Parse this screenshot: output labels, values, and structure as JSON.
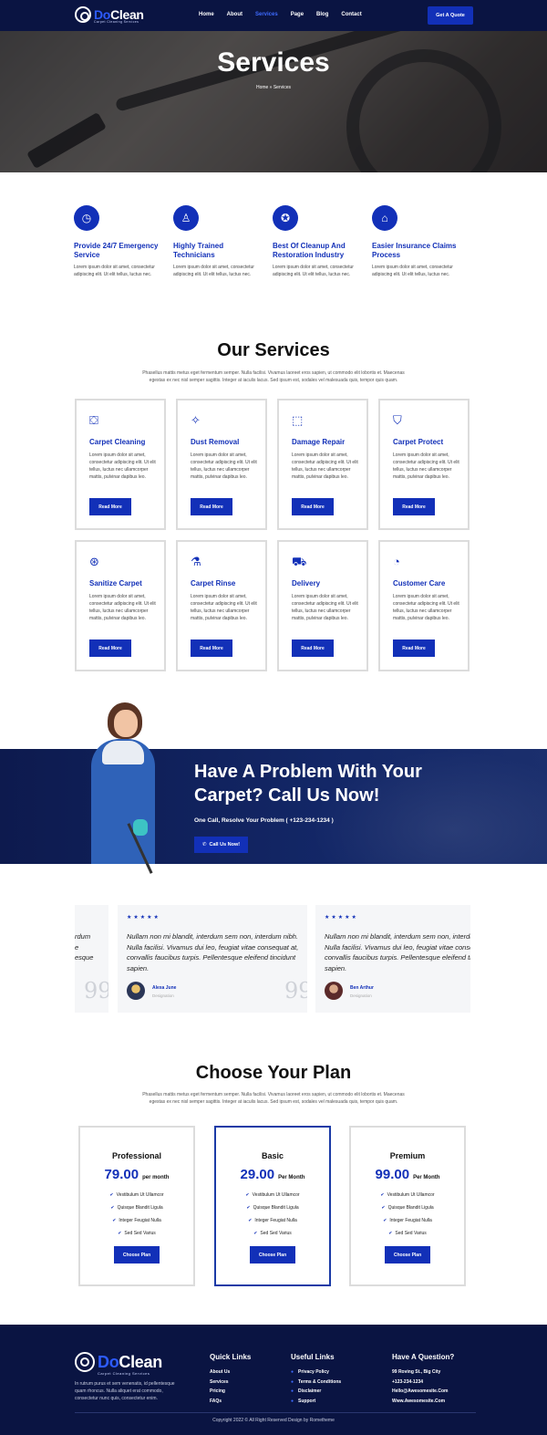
{
  "brand": {
    "name_a": "Do",
    "name_b": "Clean",
    "tagline": "Carpet Cleaning Services"
  },
  "nav": {
    "links": [
      "Home",
      "About",
      "Services",
      "Page",
      "Blog",
      "Contact"
    ],
    "active": "Services",
    "cta": "Get A Quote"
  },
  "hero": {
    "title": "Services",
    "breadcrumb": "Home » Services"
  },
  "features": [
    {
      "icon": "clock-24-icon",
      "title": "Provide 24/7 Emergency Service",
      "desc": "Lorem ipsum dolor sit amet, consectetur adipiscing elit. Ut elit tellus, luctus nec."
    },
    {
      "icon": "technician-icon",
      "title": "Highly Trained Technicians",
      "desc": "Lorem ipsum dolor sit amet, consectetur adipiscing elit. Ut elit tellus, luctus nec."
    },
    {
      "icon": "award-icon",
      "title": "Best Of Cleanup And Restoration Industry",
      "desc": "Lorem ipsum dolor sit amet, consectetur adipiscing elit. Ut elit tellus, luctus nec."
    },
    {
      "icon": "insurance-icon",
      "title": "Easier Insurance Claims Process",
      "desc": "Lorem ipsum dolor sit amet, consectetur adipiscing elit. Ut elit tellus, luctus nec."
    }
  ],
  "services": {
    "title": "Our Services",
    "desc": "Phasellus mattis metus eget fermentum semper. Nulla facilisi. Vivamus laoreet eros sapien, ut commodo elit lobortis et. Maecenas egestas ex nec nisl semper sagittis. Integer at iaculis lacus. Sed ipsum est, sodales vel malesuada quis, tempor quis quam.",
    "items": [
      {
        "icon": "cleaning-icon",
        "title": "Carpet Cleaning",
        "desc": "Lorem ipsum dolor sit amet, consectetur adipiscing elit. Ut elit tellus, luctus nec ullamcorper mattis, pulvinar dapibus leo.",
        "button": "Read More"
      },
      {
        "icon": "wand-icon",
        "title": "Dust Removal",
        "desc": "Lorem ipsum dolor sit amet, consectetur adipiscing elit. Ut elit tellus, luctus nec ullamcorper mattis, pulvinar dapibus leo.",
        "button": "Read More"
      },
      {
        "icon": "repair-icon",
        "title": "Damage Repair",
        "desc": "Lorem ipsum dolor sit amet, consectetur adipiscing elit. Ut elit tellus, luctus nec ullamcorper mattis, pulvinar dapibus leo.",
        "button": "Read More"
      },
      {
        "icon": "shield-icon",
        "title": "Carpet Protect",
        "desc": "Lorem ipsum dolor sit amet, consectetur adipiscing elit. Ut elit tellus, luctus nec ullamcorper mattis, pulvinar dapibus leo.",
        "button": "Read More"
      },
      {
        "icon": "sanitize-icon",
        "title": "Sanitize Carpet",
        "desc": "Lorem ipsum dolor sit amet, consectetur adipiscing elit. Ut elit tellus, luctus nec ullamcorper mattis, pulvinar dapibus leo.",
        "button": "Read More"
      },
      {
        "icon": "flask-icon",
        "title": "Carpet Rinse",
        "desc": "Lorem ipsum dolor sit amet, consectetur adipiscing elit. Ut elit tellus, luctus nec ullamcorper mattis, pulvinar dapibus leo.",
        "button": "Read More"
      },
      {
        "icon": "truck-icon",
        "title": "Delivery",
        "desc": "Lorem ipsum dolor sit amet, consectetur adipiscing elit. Ut elit tellus, luctus nec ullamcorper mattis, pulvinar dapibus leo.",
        "button": "Read More"
      },
      {
        "icon": "support-icon",
        "title": "Customer Care",
        "desc": "Lorem ipsum dolor sit amet, consectetur adipiscing elit. Ut elit tellus, luctus nec ullamcorper mattis, pulvinar dapibus leo.",
        "button": "Read More"
      }
    ]
  },
  "cta": {
    "title": "Have A Problem With Your Carpet? Call Us Now!",
    "subtitle": "One Call, Resolve Your Problem ( +123-234-1234 )",
    "button": "Call Us Now!"
  },
  "testimonials": {
    "stars": "★★★★★",
    "quote": "Nullam non mi blandit, interdum sem non, interdum nibh. Nulla facilisi. Vivamus dui leo, feugiat vitae consequat at, convallis faucibus turpis. Pellentesque eleifend tincidunt sapien.",
    "partial_quote": "rdum\ne\nesque",
    "items": [
      {
        "name": "Alexa June",
        "role": "Designation"
      },
      {
        "name": "Ben Arthur",
        "role": "Designation"
      }
    ],
    "quote_mark": "99"
  },
  "plans": {
    "title": "Choose Your Plan",
    "desc": "Phasellus mattis metus eget fermentum semper. Nulla facilisi. Vivamus laoreet eros sapien, ut commodo elit lobortis et. Maecenas egestas ex nec nisl semper sagittis. Integer at iaculis lacus. Sed ipsum est, sodales vel malesuada quis, tempor quis quam.",
    "items": [
      {
        "name": "Professional",
        "price": "79.00",
        "per": "per month",
        "features": [
          "Vestibulum Ut Ullamcor",
          "Quisque Blandit Ligula",
          "Integer Feugiat Nulla",
          "Sed Sed Varius"
        ],
        "button": "Choose Plan"
      },
      {
        "name": "Basic",
        "price": "29.00",
        "per": "Per Month",
        "features": [
          "Vestibulum Ut Ullamcor",
          "Quisque Blandit Ligula",
          "Integer Feugiat Nulla",
          "Sed Sed Varius"
        ],
        "button": "Choose Plan"
      },
      {
        "name": "Premium",
        "price": "99.00",
        "per": "Per Month",
        "features": [
          "Vestibulum Ut Ullamcor",
          "Quisque Blandit Ligula",
          "Integer Feugiat Nulla",
          "Sed Sed Varius"
        ],
        "button": "Choose Plan"
      }
    ]
  },
  "footer": {
    "about": "In rutrum purus et sem venenatis, id pellentesque quam rhoncus. Nulla aliquet erat commodo, consectetur nunc quis, consectetur enim.",
    "quick_links": {
      "title": "Quick Links",
      "items": [
        "About Us",
        "Services",
        "Pricing",
        "FAQs"
      ]
    },
    "useful_links": {
      "title": "Useful Links",
      "items": [
        "Privacy Policy",
        "Terms & Conditions",
        "Disclaimer",
        "Support"
      ]
    },
    "contact": {
      "title": "Have A Question?",
      "items": [
        "99 Roving St., Big City",
        "+123-234-1234",
        "Hello@Awesomesite.Com",
        "Www.Awesomesite.Com"
      ]
    },
    "copyright": "Copyright 2022 © All Right Reserved Design by Rometheme"
  },
  "colors": {
    "navy": "#0a1442",
    "accent": "#1230b8",
    "link_active": "#3e6bff"
  }
}
